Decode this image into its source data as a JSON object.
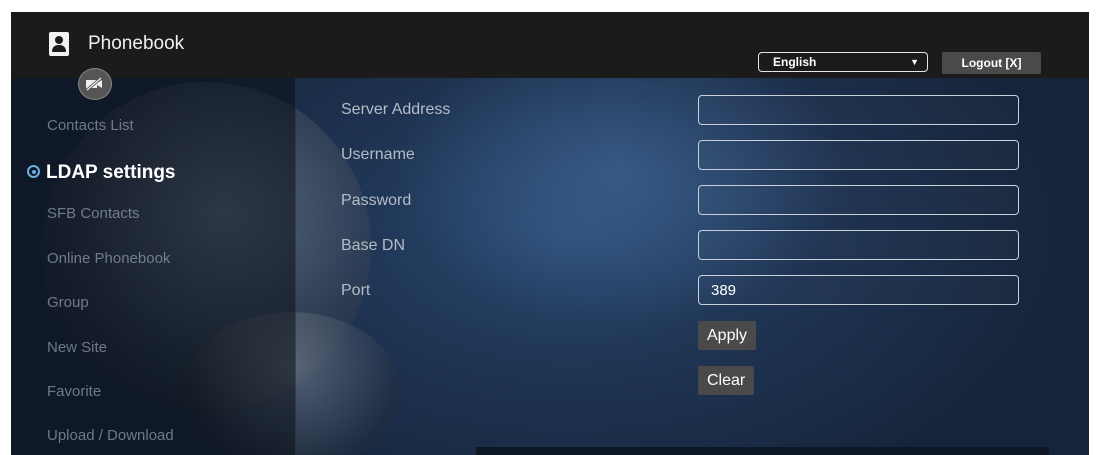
{
  "header": {
    "title": "Phonebook",
    "language": "English",
    "logout_label": "Logout [X]"
  },
  "sidebar": {
    "items": [
      {
        "label": "Contacts List",
        "active": false
      },
      {
        "label": "LDAP settings",
        "active": true
      },
      {
        "label": "SFB Contacts",
        "active": false
      },
      {
        "label": "Online Phonebook",
        "active": false
      },
      {
        "label": "Group",
        "active": false
      },
      {
        "label": "New Site",
        "active": false
      },
      {
        "label": "Favorite",
        "active": false
      },
      {
        "label": "Upload / Download",
        "active": false
      }
    ]
  },
  "form": {
    "fields": [
      {
        "label": "Server Address",
        "value": ""
      },
      {
        "label": "Username",
        "value": ""
      },
      {
        "label": "Password",
        "value": ""
      },
      {
        "label": "Base DN",
        "value": ""
      },
      {
        "label": "Port",
        "value": "389"
      }
    ],
    "apply_label": "Apply",
    "clear_label": "Clear"
  },
  "icons": {
    "logo": "contact-book-icon",
    "camera_off": "camera-off-icon",
    "active_marker": "radio-selected-icon"
  }
}
